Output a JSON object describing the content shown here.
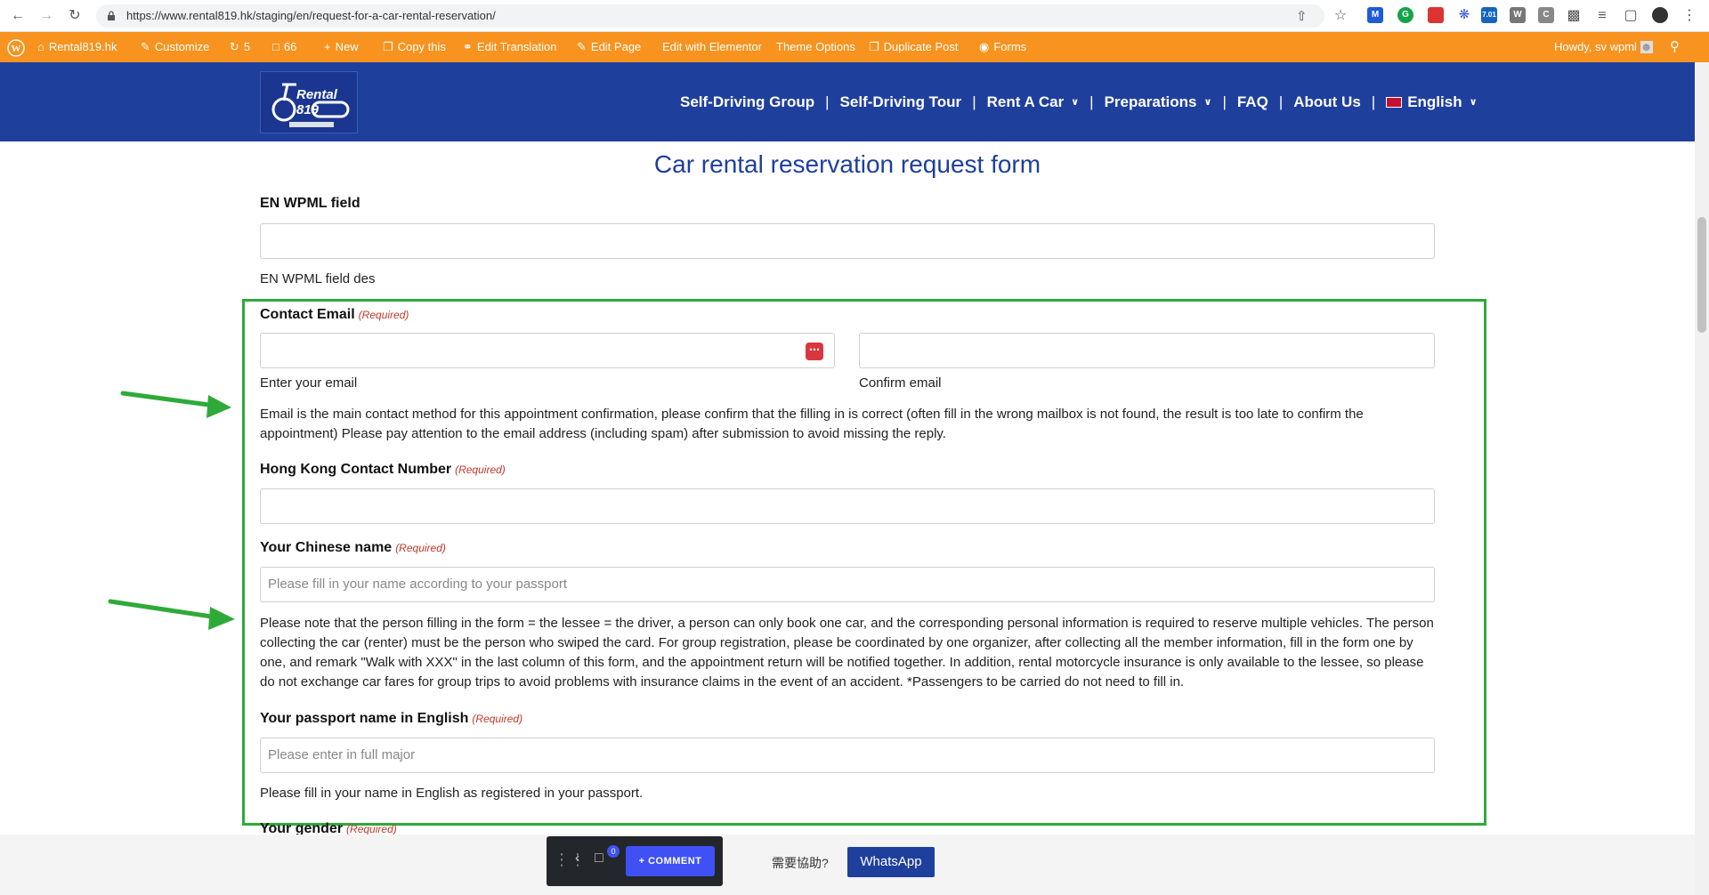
{
  "browser": {
    "url": "https://www.rental819.hk/staging/en/request-for-a-car-rental-reservation/",
    "ext_badge_1": "",
    "ext_badge_2": "7.01"
  },
  "adminbar": {
    "site": "Rental819.hk",
    "customize": "Customize",
    "updates": "5",
    "comments": "66",
    "new": "New",
    "copy": "Copy this",
    "translation": "Edit Translation",
    "edit_page": "Edit Page",
    "elementor": "Edit with Elementor",
    "theme_options": "Theme Options",
    "duplicate": "Duplicate Post",
    "forms": "Forms",
    "howdy": "Howdy, sv wpml"
  },
  "nav": {
    "items": [
      "Self-Driving Group",
      "Self-Driving Tour",
      "Rent A Car",
      "Preparations",
      "FAQ",
      "About Us",
      "English"
    ],
    "separator": "|"
  },
  "form": {
    "title": "Car rental reservation request form",
    "wpml_label": "EN WPML field",
    "wpml_desc": "EN WPML field des",
    "required": "(Required)",
    "email_label": "Contact Email",
    "email_sub": "Enter your email",
    "confirm_sub": "Confirm email",
    "email_note": "Email is the main contact method for this appointment confirmation, please confirm that the filling in is correct (often fill in the wrong mailbox is not found, the result is too late to confirm the appointment) Please pay attention to the email address (including spam) after submission to avoid missing the reply.",
    "phone_label": "Hong Kong Contact Number",
    "chinese_name_label": "Your Chinese name",
    "chinese_name_placeholder": "Please fill in your name according to your passport",
    "lessee_note": "Please note that the person filling in the form = the lessee = the driver, a person can only book one car, and the corresponding personal information is required to reserve multiple vehicles. The person collecting the car (renter) must be the person who swiped the card. For group registration, please be coordinated by one organizer, after collecting all the member information, fill in the form one by one, and remark \"Walk with XXX\" in the last column of this form, and the appointment return will be notified together. In addition, rental motorcycle insurance is only available to the lessee, so please do not exchange car fares for group trips to avoid problems with insurance claims in the event of an accident. *Passengers to be carried do not need to fill in.",
    "passport_label": "Your passport name in English",
    "passport_placeholder": "Please enter in full major",
    "passport_note": "Please fill in your name in English as registered in your passport.",
    "gender_label": "Your gender"
  },
  "bottom": {
    "comment_count": "0",
    "comment_label": "+ COMMENT",
    "help_text": "需要協助?",
    "whatsapp": "WhatsApp"
  },
  "colors": {
    "admin_bar": "#f7931e",
    "header": "#1f3f9d",
    "highlight": "#2eaa39",
    "required": "#c0392b"
  }
}
